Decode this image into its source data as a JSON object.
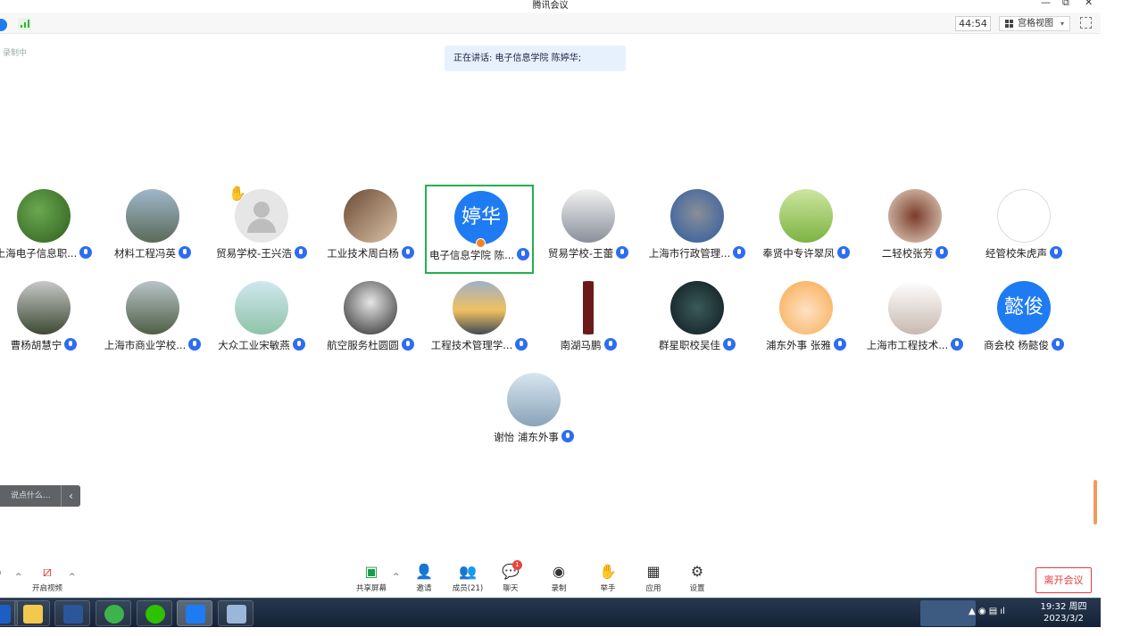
{
  "window": {
    "title": "腾讯会议",
    "minimize": "—",
    "restore": "⧉",
    "close": "✕"
  },
  "topbar": {
    "timer": "44:54",
    "view_label": "宫格视图",
    "view_caret": "▾"
  },
  "status": {
    "recording": "录制中",
    "speaking": "正在讲话: 电子信息学院 陈婷华;"
  },
  "participants": [
    {
      "name": "上海电子信息职...",
      "avatar": "photo-leaves"
    },
    {
      "name": "材料工程冯英",
      "avatar": "photo-people"
    },
    {
      "name": "贸易学校-王兴浩",
      "avatar": "default",
      "hand_raised": true
    },
    {
      "name": "工业技术周白杨",
      "avatar": "photo-cat"
    },
    {
      "name": "电子信息学院  陈...",
      "avatar": "initials",
      "initials": "婷华",
      "active": true
    },
    {
      "name": "贸易学校-王蕾",
      "avatar": "photo-girl"
    },
    {
      "name": "上海市行政管理...",
      "avatar": "photo-dog"
    },
    {
      "name": "奉贤中专许翠凤",
      "avatar": "photo-field"
    },
    {
      "name": "二轻校张芳",
      "avatar": "photo-cake"
    },
    {
      "name": "经管校朱虎声",
      "avatar": "sketch"
    },
    {
      "name": "曹杨胡慧宁",
      "avatar": "photo-tree"
    },
    {
      "name": "上海市商业学校...",
      "avatar": "photo-road"
    },
    {
      "name": "大众工业宋敏燕",
      "avatar": "photo-swing"
    },
    {
      "name": "航空服务杜圆圆",
      "avatar": "photo-boy"
    },
    {
      "name": "工程技术管理学...",
      "avatar": "photo-sunset"
    },
    {
      "name": "南湖马鹏",
      "avatar": "photo-bottle"
    },
    {
      "name": "群星职校吴佳",
      "avatar": "photo-dark"
    },
    {
      "name": "浦东外事 张雅",
      "avatar": "photo-cartoon"
    },
    {
      "name": "上海市工程技术...",
      "avatar": "photo-bunny"
    },
    {
      "name": "商会校 杨懿俊",
      "avatar": "initials",
      "initials": "懿俊"
    },
    {
      "name": "谢怡 浦东外事",
      "avatar": "photo-beach"
    }
  ],
  "chat": {
    "placeholder": "说点什么...",
    "arrow": "‹"
  },
  "controls": {
    "audio_label": "音",
    "video_label": "开启视频",
    "share_label": "共享屏幕",
    "invite_label": "邀请",
    "members_label": "成员(21)",
    "chat_label": "聊天",
    "chat_badge": "1",
    "record_label": "录制",
    "raise_hand_label": "举手",
    "apps_label": "应用",
    "settings_label": "设置",
    "leave_label": "离开会议"
  },
  "taskbar": {
    "time": "19:32 周四",
    "date": "2023/3/2"
  }
}
